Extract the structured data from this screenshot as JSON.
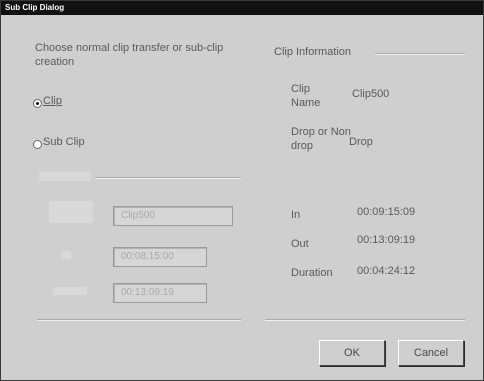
{
  "window": {
    "title": "Sub Clip Dialog"
  },
  "instruction": "Choose normal clip transfer or sub-clip creation",
  "options": {
    "clip_label": "Clip",
    "subclip_label": "Sub Clip",
    "selected": "clip"
  },
  "subclip_fields": {
    "name_value": "Clip500",
    "in_value": "00:08:15:00",
    "out_value": "00:13:09:19"
  },
  "clip_info": {
    "title": "Clip Information",
    "clip_name_label": "Clip Name",
    "clip_name_value": "Clip500",
    "drop_label": "Drop or Non drop",
    "drop_value": "Drop",
    "in_label": "In",
    "in_value": "00:09:15:09",
    "out_label": "Out",
    "out_value": "00:13:09:19",
    "duration_label": "Duration",
    "duration_value": "00:04:24:12"
  },
  "buttons": {
    "ok": "OK",
    "cancel": "Cancel"
  }
}
